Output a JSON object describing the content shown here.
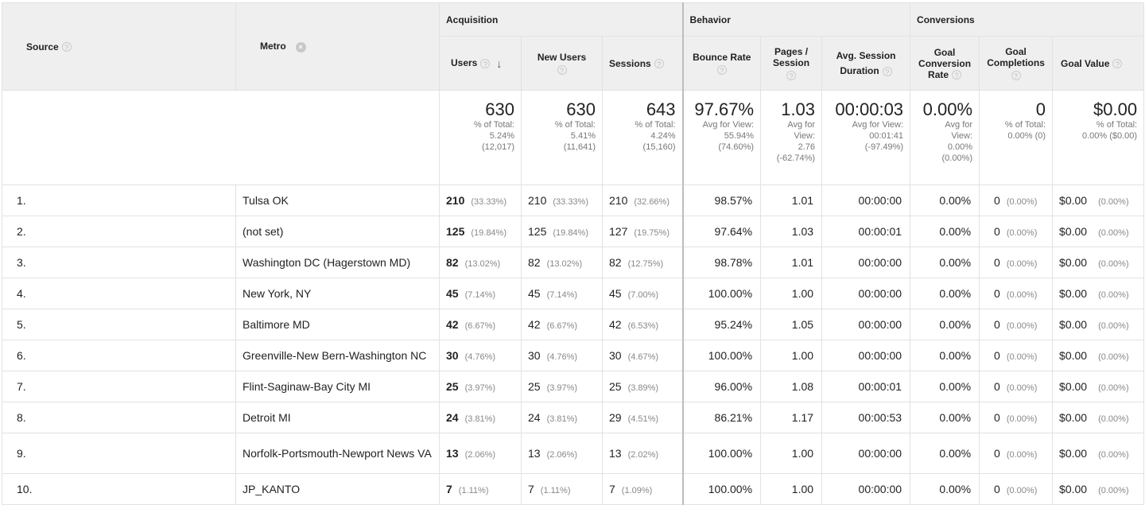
{
  "header": {
    "source": "Source",
    "metro": "Metro",
    "groups": {
      "acquisition": "Acquisition",
      "behavior": "Behavior",
      "conversions": "Conversions"
    },
    "columns": {
      "users": "Users",
      "new_users": "New Users",
      "sessions": "Sessions",
      "bounce_rate": "Bounce Rate",
      "pages_session_1": "Pages /",
      "pages_session_2": "Session",
      "avg_duration_1": "Avg. Session",
      "avg_duration_2": "Duration",
      "goal_conv_1": "Goal",
      "goal_conv_2": "Conversion",
      "goal_conv_3": "Rate",
      "goal_comp_1": "Goal",
      "goal_comp_2": "Completions",
      "goal_value": "Goal Value"
    },
    "icons": {
      "help": "help-icon",
      "remove": "remove-dimension-icon",
      "sort": "sort-desc-icon"
    }
  },
  "totals": {
    "users": {
      "value": "630",
      "l1": "% of Total:",
      "l2": "5.24%",
      "l3": "(12,017)"
    },
    "new_users": {
      "value": "630",
      "l1": "% of Total:",
      "l2": "5.41%",
      "l3": "(11,641)"
    },
    "sessions": {
      "value": "643",
      "l1": "% of Total:",
      "l2": "4.24%",
      "l3": "(15,160)"
    },
    "bounce_rate": {
      "value": "97.67%",
      "l1": "Avg for View:",
      "l2": "55.94%",
      "l3": "(74.60%)"
    },
    "pages_session": {
      "value": "1.03",
      "l1": "Avg for",
      "l2": "View:",
      "l3": "2.76",
      "l4": "(-62.74%)"
    },
    "avg_duration": {
      "value": "00:00:03",
      "l1": "Avg for View:",
      "l2": "00:01:41",
      "l3": "(-97.49%)"
    },
    "goal_conv": {
      "value": "0.00%",
      "l1": "Avg for",
      "l2": "View:",
      "l3": "0.00%",
      "l4": "(0.00%)"
    },
    "goal_comp": {
      "value": "0",
      "l1": "% of Total:",
      "l2": "0.00% (0)"
    },
    "goal_value": {
      "value": "$0.00",
      "l1": "% of Total:",
      "l2": "0.00% ($0.00)"
    }
  },
  "rows": [
    {
      "idx": "1.",
      "metro": "Tulsa OK",
      "users": "210",
      "users_pct": "(33.33%)",
      "new": "210",
      "new_pct": "(33.33%)",
      "sess": "210",
      "sess_pct": "(32.66%)",
      "bounce": "98.57%",
      "pages": "1.01",
      "dur": "00:00:00",
      "gcr": "0.00%",
      "gc": "0",
      "gc_pct": "(0.00%)",
      "gv": "$0.00",
      "gv_pct": "(0.00%)"
    },
    {
      "idx": "2.",
      "metro": "(not set)",
      "users": "125",
      "users_pct": "(19.84%)",
      "new": "125",
      "new_pct": "(19.84%)",
      "sess": "127",
      "sess_pct": "(19.75%)",
      "bounce": "97.64%",
      "pages": "1.03",
      "dur": "00:00:01",
      "gcr": "0.00%",
      "gc": "0",
      "gc_pct": "(0.00%)",
      "gv": "$0.00",
      "gv_pct": "(0.00%)"
    },
    {
      "idx": "3.",
      "metro": "Washington DC (Hagerstown MD)",
      "users": "82",
      "users_pct": "(13.02%)",
      "new": "82",
      "new_pct": "(13.02%)",
      "sess": "82",
      "sess_pct": "(12.75%)",
      "bounce": "98.78%",
      "pages": "1.01",
      "dur": "00:00:00",
      "gcr": "0.00%",
      "gc": "0",
      "gc_pct": "(0.00%)",
      "gv": "$0.00",
      "gv_pct": "(0.00%)"
    },
    {
      "idx": "4.",
      "metro": "New York, NY",
      "users": "45",
      "users_pct": "(7.14%)",
      "new": "45",
      "new_pct": "(7.14%)",
      "sess": "45",
      "sess_pct": "(7.00%)",
      "bounce": "100.00%",
      "pages": "1.00",
      "dur": "00:00:00",
      "gcr": "0.00%",
      "gc": "0",
      "gc_pct": "(0.00%)",
      "gv": "$0.00",
      "gv_pct": "(0.00%)"
    },
    {
      "idx": "5.",
      "metro": "Baltimore MD",
      "users": "42",
      "users_pct": "(6.67%)",
      "new": "42",
      "new_pct": "(6.67%)",
      "sess": "42",
      "sess_pct": "(6.53%)",
      "bounce": "95.24%",
      "pages": "1.05",
      "dur": "00:00:00",
      "gcr": "0.00%",
      "gc": "0",
      "gc_pct": "(0.00%)",
      "gv": "$0.00",
      "gv_pct": "(0.00%)"
    },
    {
      "idx": "6.",
      "metro": "Greenville-New Bern-Washington NC",
      "users": "30",
      "users_pct": "(4.76%)",
      "new": "30",
      "new_pct": "(4.76%)",
      "sess": "30",
      "sess_pct": "(4.67%)",
      "bounce": "100.00%",
      "pages": "1.00",
      "dur": "00:00:00",
      "gcr": "0.00%",
      "gc": "0",
      "gc_pct": "(0.00%)",
      "gv": "$0.00",
      "gv_pct": "(0.00%)"
    },
    {
      "idx": "7.",
      "metro": "Flint-Saginaw-Bay City MI",
      "users": "25",
      "users_pct": "(3.97%)",
      "new": "25",
      "new_pct": "(3.97%)",
      "sess": "25",
      "sess_pct": "(3.89%)",
      "bounce": "96.00%",
      "pages": "1.08",
      "dur": "00:00:01",
      "gcr": "0.00%",
      "gc": "0",
      "gc_pct": "(0.00%)",
      "gv": "$0.00",
      "gv_pct": "(0.00%)"
    },
    {
      "idx": "8.",
      "metro": "Detroit MI",
      "users": "24",
      "users_pct": "(3.81%)",
      "new": "24",
      "new_pct": "(3.81%)",
      "sess": "29",
      "sess_pct": "(4.51%)",
      "bounce": "86.21%",
      "pages": "1.17",
      "dur": "00:00:53",
      "gcr": "0.00%",
      "gc": "0",
      "gc_pct": "(0.00%)",
      "gv": "$0.00",
      "gv_pct": "(0.00%)"
    },
    {
      "idx": "9.",
      "metro": "Norfolk-Portsmouth-Newport News VA",
      "users": "13",
      "users_pct": "(2.06%)",
      "new": "13",
      "new_pct": "(2.06%)",
      "sess": "13",
      "sess_pct": "(2.02%)",
      "bounce": "100.00%",
      "pages": "1.00",
      "dur": "00:00:00",
      "gcr": "0.00%",
      "gc": "0",
      "gc_pct": "(0.00%)",
      "gv": "$0.00",
      "gv_pct": "(0.00%)"
    },
    {
      "idx": "10.",
      "metro": "JP_KANTO",
      "users": "7",
      "users_pct": "(1.11%)",
      "new": "7",
      "new_pct": "(1.11%)",
      "sess": "7",
      "sess_pct": "(1.09%)",
      "bounce": "100.00%",
      "pages": "1.00",
      "dur": "00:00:00",
      "gcr": "0.00%",
      "gc": "0",
      "gc_pct": "(0.00%)",
      "gv": "$0.00",
      "gv_pct": "(0.00%)"
    }
  ]
}
